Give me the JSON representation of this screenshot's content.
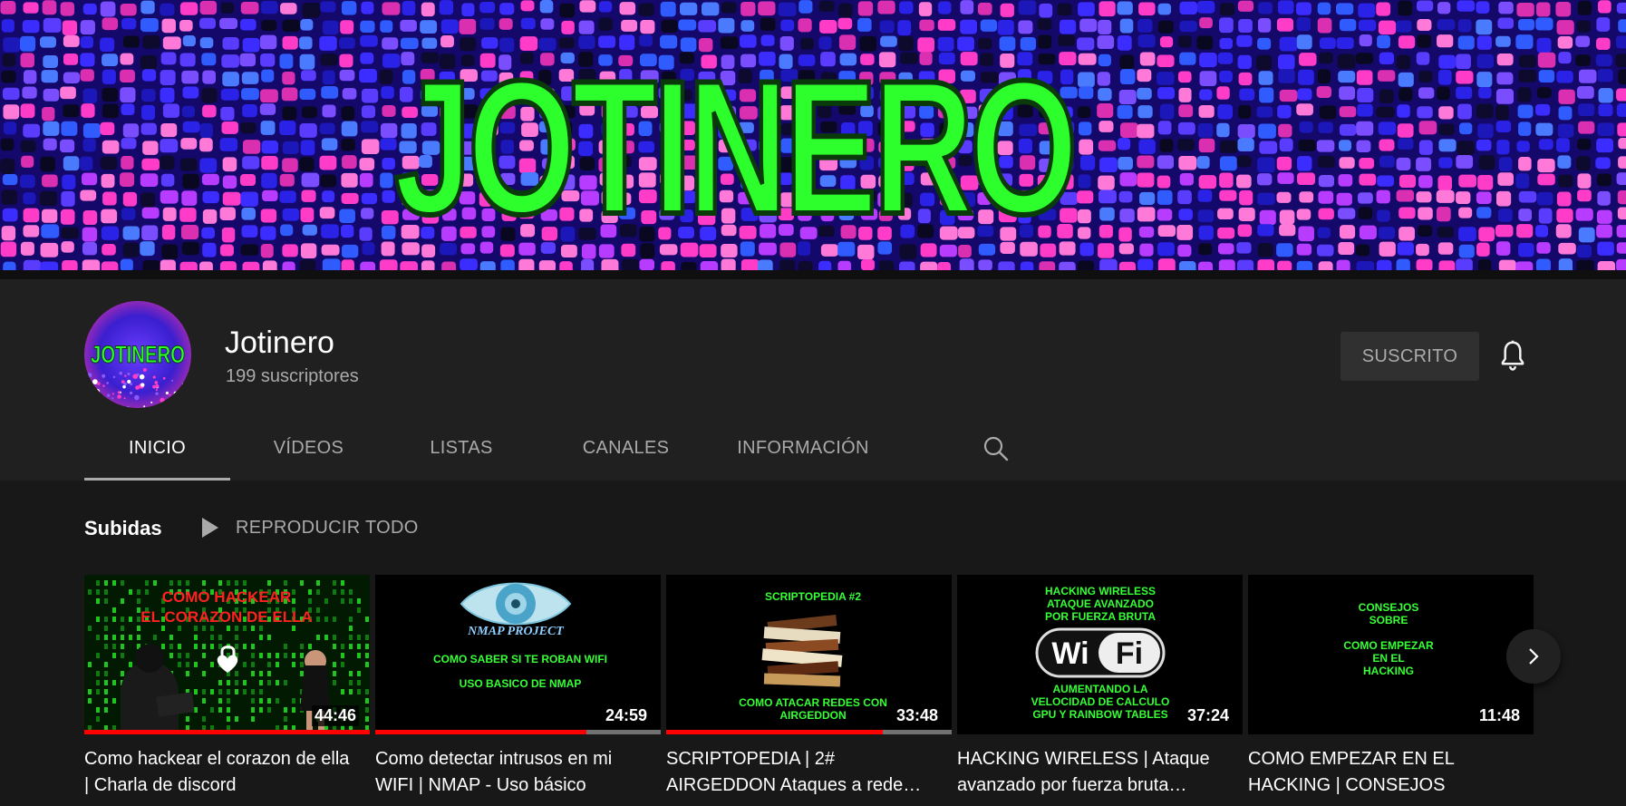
{
  "banner": {
    "logo_text": "JOTINERO",
    "colors": {
      "glass_blue": "#2a22e6",
      "glass_pink": "#ff3cc8",
      "logo_green": "#2dff2d"
    }
  },
  "channel": {
    "name": "Jotinero",
    "subscribers": "199 suscriptores",
    "avatar_logo_text": "JOTINERO",
    "subscribe_label": "SUSCRITO"
  },
  "tabs": [
    {
      "label": "INICIO",
      "active": true
    },
    {
      "label": "VÍDEOS",
      "active": false
    },
    {
      "label": "LISTAS",
      "active": false
    },
    {
      "label": "CANALES",
      "active": false
    },
    {
      "label": "INFORMACIÓN",
      "active": false
    }
  ],
  "shelf": {
    "title": "Subidas",
    "play_all_label": "REPRODUCIR TODO"
  },
  "videos": [
    {
      "title": "Como hackear el corazon de ella | Charla de discord",
      "duration": "44:46",
      "progress": 1.0,
      "thumb_text": [
        "COMO HACKEAR",
        "EL CORAZON DE ELLA"
      ]
    },
    {
      "title": "Como detectar intrusos en mi WIFI | NMAP - Uso básico",
      "duration": "24:59",
      "progress": 0.74,
      "thumb_text": [
        "NMAP PROJECT",
        "COMO SABER SI TE ROBAN WIFI",
        "USO BASICO DE NMAP"
      ]
    },
    {
      "title": "SCRIPTOPEDIA | 2# AIRGEDDON Ataques a rede…",
      "duration": "33:48",
      "progress": 0.76,
      "thumb_text": [
        "SCRIPTOPEDIA #2",
        "COMO ATACAR REDES CON",
        "AIRGEDDON"
      ]
    },
    {
      "title": "HACKING WIRELESS | Ataque avanzado por fuerza bruta…",
      "duration": "37:24",
      "progress": 0,
      "thumb_text": [
        "HACKING WIRELESS",
        "ATAQUE AVANZADO",
        "POR FUERZA BRUTA",
        "Wi Fi",
        "AUMENTANDO LA",
        "VELOCIDAD DE CALCULO",
        "GPU Y RAINBOW TABLES"
      ]
    },
    {
      "title": "COMO EMPEZAR EN EL HACKING | CONSEJOS",
      "duration": "11:48",
      "progress": 0,
      "thumb_text": [
        "CONSEJOS",
        "SOBRE",
        "COMO EMPEZAR",
        "EN EL",
        "HACKING"
      ]
    }
  ],
  "icons": {
    "bell": "bell-icon",
    "search": "search-icon",
    "play": "play-icon",
    "next": "chevron-right-icon"
  }
}
